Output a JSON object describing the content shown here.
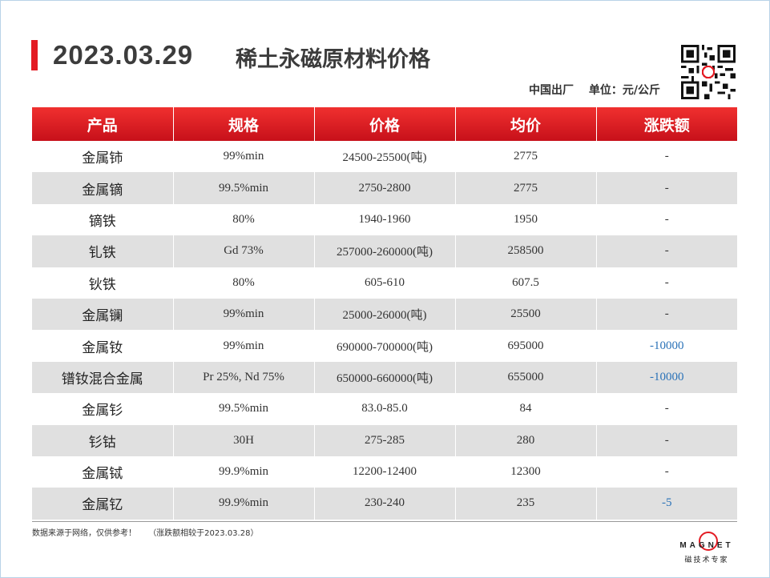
{
  "header": {
    "date": "2023.03.29",
    "title": "稀土永磁原材料价格",
    "origin": "中国出厂",
    "unit": "单位：元/公斤"
  },
  "table": {
    "columns": [
      "产品",
      "规格",
      "价格",
      "均价",
      "涨跌额"
    ],
    "rows": [
      {
        "product": "金属铈",
        "spec": "99%min",
        "price": "24500-25500(吨)",
        "avg": "2775",
        "change": "-"
      },
      {
        "product": "金属镝",
        "spec": "99.5%min",
        "price": "2750-2800",
        "avg": "2775",
        "change": "-"
      },
      {
        "product": "镝铁",
        "spec": "80%",
        "price": "1940-1960",
        "avg": "1950",
        "change": "-"
      },
      {
        "product": "钆铁",
        "spec": "Gd 73%",
        "price": "257000-260000(吨)",
        "avg": "258500",
        "change": "-"
      },
      {
        "product": "钬铁",
        "spec": "80%",
        "price": "605-610",
        "avg": "607.5",
        "change": "-"
      },
      {
        "product": "金属镧",
        "spec": "99%min",
        "price": "25000-26000(吨)",
        "avg": "25500",
        "change": "-"
      },
      {
        "product": "金属钕",
        "spec": "99%min",
        "price": "690000-700000(吨)",
        "avg": "695000",
        "change": "-10000"
      },
      {
        "product": "镨钕混合金属",
        "spec": "Pr 25%, Nd 75%",
        "price": "650000-660000(吨)",
        "avg": "655000",
        "change": "-10000"
      },
      {
        "product": "金属钐",
        "spec": "99.5%min",
        "price": "83.0-85.0",
        "avg": "84",
        "change": "-"
      },
      {
        "product": "钐钴",
        "spec": "30H",
        "price": "275-285",
        "avg": "280",
        "change": "-"
      },
      {
        "product": "金属铽",
        "spec": "99.9%min",
        "price": "12200-12400",
        "avg": "12300",
        "change": "-"
      },
      {
        "product": "金属钇",
        "spec": "99.9%min",
        "price": "230-240",
        "avg": "235",
        "change": "-5"
      }
    ]
  },
  "footer": {
    "source_note": "数据来源于网络，仅供参考！",
    "compare_note": "（涨跌额相较于2023.03.28）"
  },
  "logo": {
    "word": "MAGNET",
    "cn": "磁技术专家"
  },
  "colors": {
    "accent_red": "#e31b23",
    "negative_change": "#2a72b8"
  }
}
